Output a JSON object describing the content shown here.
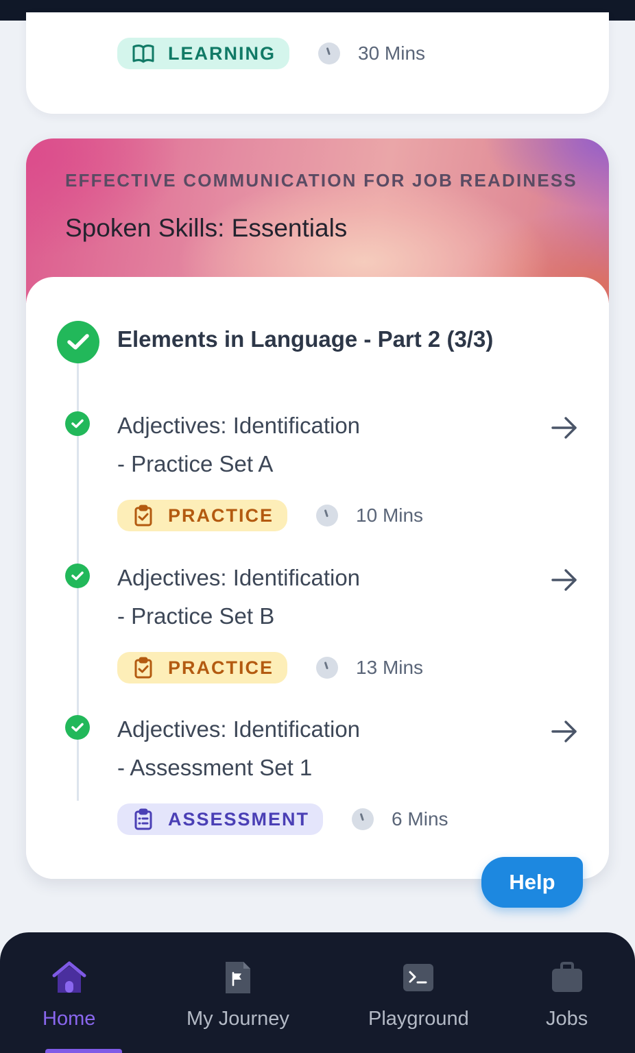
{
  "top_card": {
    "tag_label": "LEARNING",
    "tag_icon": "book-open-icon",
    "duration": "30 Mins"
  },
  "course": {
    "eyebrow": "EFFECTIVE COMMUNICATION FOR JOB READINESS",
    "title": "Spoken Skills: Essentials"
  },
  "section": {
    "title": "Elements in Language - Part 2 (3/3)",
    "status": "completed"
  },
  "lessons": [
    {
      "title_line1": "Adjectives: Identification",
      "title_line2": "- Practice Set A",
      "type": "PRACTICE",
      "duration": "10 Mins",
      "completed": true
    },
    {
      "title_line1": "Adjectives: Identification",
      "title_line2": "- Practice Set B",
      "type": "PRACTICE",
      "duration": "13 Mins",
      "completed": true
    },
    {
      "title_line1": "Adjectives: Identification",
      "title_line2": "- Assessment Set 1",
      "type": "ASSESSMENT",
      "duration": "6 Mins",
      "completed": true
    }
  ],
  "help_button": {
    "label": "Help"
  },
  "bottom_nav": {
    "items": [
      {
        "label": "Home",
        "icon": "home-icon",
        "active": true
      },
      {
        "label": "My Journey",
        "icon": "journey-flag-icon",
        "active": false
      },
      {
        "label": "Playground",
        "icon": "terminal-icon",
        "active": false
      },
      {
        "label": "Jobs",
        "icon": "briefcase-icon",
        "active": false
      }
    ]
  },
  "colors": {
    "accent": "#8a67ef",
    "success": "#22b85a",
    "help": "#1d88e0",
    "nav_bg": "#141a2b"
  }
}
